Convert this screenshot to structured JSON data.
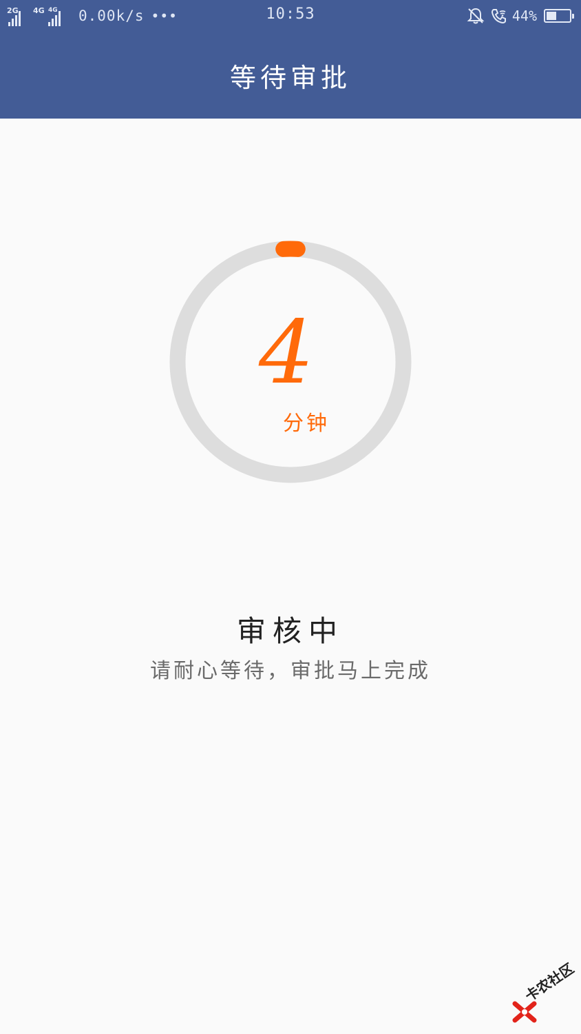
{
  "status_bar": {
    "network_1": "2G",
    "network_2": "4G",
    "network_3": "4G",
    "speed": "0.00k/s",
    "more": "•••",
    "time": "10:53",
    "battery_percent": "44%",
    "battery_level": 0.44
  },
  "header": {
    "title": "等待审批"
  },
  "timer": {
    "value": "4",
    "unit": "分钟",
    "progress": 0.02,
    "colors": {
      "accent": "#ff6a0a",
      "track": "#dddddd"
    }
  },
  "status": {
    "title": "审核中",
    "subtitle": "请耐心等待，审批马上完成"
  },
  "watermark": {
    "text": "卡农社区"
  },
  "colors": {
    "header_bg": "#435c96",
    "page_bg": "#fafafa"
  },
  "icons": [
    "signal-icon",
    "bell-off-icon",
    "wifi-call-icon",
    "battery-icon"
  ]
}
